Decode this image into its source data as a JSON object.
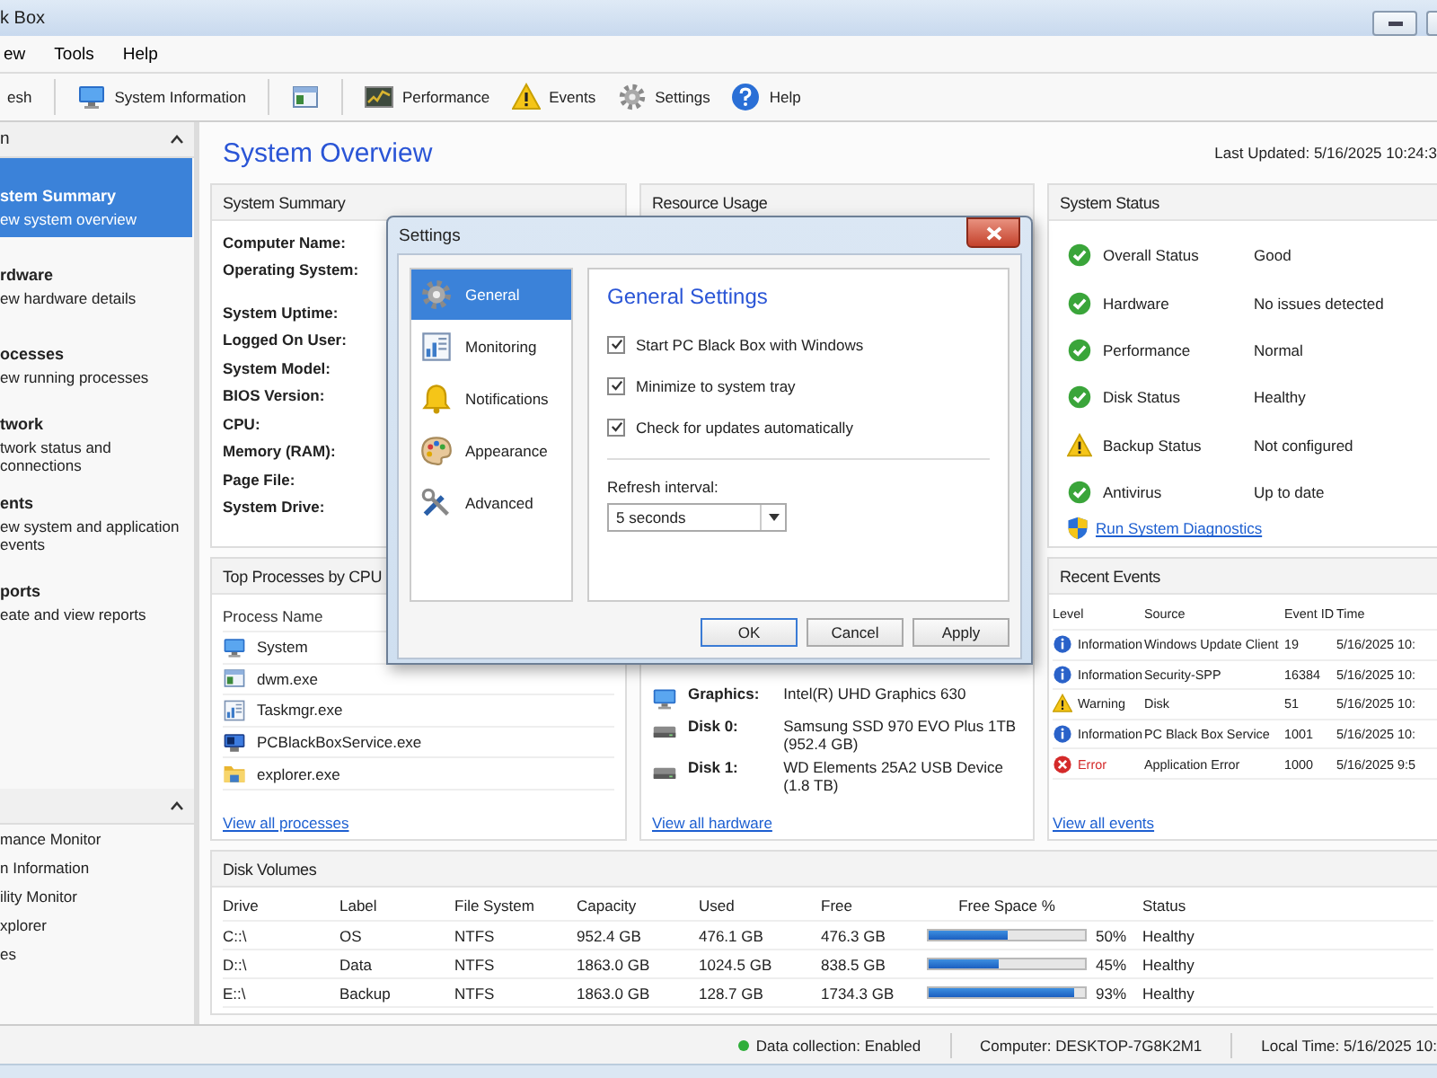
{
  "window": {
    "title": "k Box"
  },
  "menu": [
    {
      "label": "ew"
    },
    {
      "label": "Tools"
    },
    {
      "label": "Help"
    }
  ],
  "toolbar": [
    {
      "kind": "button",
      "label": "esh"
    },
    {
      "kind": "separator"
    },
    {
      "kind": "button",
      "label": "System Information"
    },
    {
      "kind": "separator"
    },
    {
      "kind": "button"
    },
    {
      "kind": "separator"
    },
    {
      "kind": "button",
      "label": "Performance"
    },
    {
      "kind": "button",
      "label": "Events"
    },
    {
      "kind": "button",
      "label": "Settings"
    },
    {
      "kind": "button",
      "label": "Help"
    }
  ],
  "sidebar": {
    "sections": [
      {
        "title": "n",
        "expanded": true,
        "items": [
          {
            "title": "stem Summary",
            "subtitle": "ew system overview",
            "selected": true
          },
          {
            "title": "rdware",
            "subtitle": "ew hardware details",
            "selected": false
          },
          {
            "title": "ocesses",
            "subtitle": "ew running processes",
            "selected": false
          },
          {
            "title": "twork",
            "subtitle": "twork status and connections",
            "selected": false
          },
          {
            "title": "ents",
            "subtitle": "ew system and application events",
            "selected": false
          },
          {
            "title": "ports",
            "subtitle": "eate and view reports",
            "selected": false
          }
        ]
      },
      {
        "expanded": true,
        "items": [
          {
            "title": "mance Monitor",
            "selected": false
          },
          {
            "title": "n Information",
            "selected": false
          },
          {
            "title": "ility Monitor",
            "selected": false
          },
          {
            "title": "xplorer",
            "selected": false
          },
          {
            "title": "es",
            "selected": false
          }
        ]
      }
    ]
  },
  "main": {
    "title": "System Overview",
    "last_updated": "Last Updated: 5/16/2025 10:24:3"
  },
  "system_summary": {
    "title": "System Summary",
    "fields": [
      "Computer Name:",
      "Operating System:",
      "System Uptime:",
      "Logged On User:",
      "System Model:",
      "BIOS Version:",
      "CPU:",
      "Memory (RAM):",
      "Page File:",
      "System Drive:"
    ]
  },
  "resource_usage": {
    "title": "Resource Usage",
    "rows": [
      {
        "kind": "graphics",
        "label": "Graphics:",
        "value": "Intel(R) UHD Graphics 630"
      },
      {
        "kind": "disk",
        "label": "Disk 0:",
        "value": "Samsung SSD 970 EVO Plus 1TB (952.4 GB)"
      },
      {
        "kind": "disk",
        "label": "Disk 1:",
        "value": "WD Elements 25A2 USB Device (1.8 TB)"
      }
    ],
    "link": "View all hardware"
  },
  "top_processes": {
    "title": "Top Processes by CPU",
    "columns": [
      "Process Name"
    ],
    "rows": [
      {
        "name": "System"
      },
      {
        "name": "dwm.exe"
      },
      {
        "name": "Taskmgr.exe"
      },
      {
        "name": "PCBlackBoxService.exe"
      },
      {
        "name": "explorer.exe"
      }
    ],
    "link": "View all processes"
  },
  "system_status": {
    "title": "System Status",
    "items": [
      {
        "kind": "ok",
        "label": "Overall Status",
        "value": "Good"
      },
      {
        "kind": "ok",
        "label": "Hardware",
        "value": "No issues detected"
      },
      {
        "kind": "ok",
        "label": "Performance",
        "value": "Normal"
      },
      {
        "kind": "ok",
        "label": "Disk Status",
        "value": "Healthy"
      },
      {
        "kind": "warning",
        "label": "Backup Status",
        "value": "Not configured"
      },
      {
        "kind": "ok",
        "label": "Antivirus",
        "value": "Up to date"
      }
    ],
    "link": "Run System Diagnostics"
  },
  "recent_events": {
    "title": "Recent Events",
    "columns": [
      "Level",
      "Source",
      "Event ID",
      "Time"
    ],
    "rows": [
      {
        "kind": "info",
        "level": "Information",
        "source": "Windows Update Client",
        "event_id": "19",
        "time": "5/16/2025 10:"
      },
      {
        "kind": "info",
        "level": "Information",
        "source": "Security-SPP",
        "event_id": "16384",
        "time": "5/16/2025 10:"
      },
      {
        "kind": "warning",
        "level": "Warning",
        "source": "Disk",
        "event_id": "51",
        "time": "5/16/2025 10:"
      },
      {
        "kind": "info",
        "level": "Information",
        "source": "PC Black Box Service",
        "event_id": "1001",
        "time": "5/16/2025 10:"
      },
      {
        "kind": "error",
        "level": "Error",
        "source": "Application Error",
        "event_id": "1000",
        "time": "5/16/2025 9:5"
      }
    ],
    "link": "View all events"
  },
  "disk_volumes": {
    "title": "Disk Volumes",
    "columns": [
      "Drive",
      "Label",
      "File System",
      "Capacity",
      "Used",
      "Free",
      "Free Space %",
      "Status"
    ],
    "rows": [
      {
        "drive": "C::\\",
        "label": "OS",
        "file_system": "NTFS",
        "capacity": "952.4 GB",
        "used": "476.1 GB",
        "free": "476.3 GB",
        "level": 0.5,
        "percent": "50%",
        "status": "Healthy"
      },
      {
        "drive": "D::\\",
        "label": "Data",
        "file_system": "NTFS",
        "capacity": "1863.0 GB",
        "used": "1024.5 GB",
        "free": "838.5 GB",
        "level": 0.45,
        "percent": "45%",
        "status": "Healthy"
      },
      {
        "drive": "E::\\",
        "label": "Backup",
        "file_system": "NTFS",
        "capacity": "1863.0 GB",
        "used": "128.7 GB",
        "free": "1734.3 GB",
        "level": 0.93,
        "percent": "93%",
        "status": "Healthy"
      }
    ]
  },
  "status_bar": {
    "data_collection": {
      "text": "Data collection: Enabled",
      "active": true
    },
    "computer": "Computer: DESKTOP-7G8K2M1",
    "local_time": "Local Time: 5/16/2025 10:"
  },
  "dialog": {
    "title": "Settings",
    "nav": [
      {
        "label": "General",
        "selected": true
      },
      {
        "label": "Monitoring",
        "selected": false
      },
      {
        "label": "Notifications",
        "selected": false
      },
      {
        "label": "Appearance",
        "selected": false
      },
      {
        "label": "Advanced",
        "selected": false
      }
    ],
    "heading": "General Settings",
    "checkboxes": [
      {
        "label": "Start PC Black Box with Windows",
        "checked": true
      },
      {
        "label": "Minimize to system tray",
        "checked": true
      },
      {
        "label": "Check for updates automatically",
        "checked": true
      }
    ],
    "refresh": {
      "label": "Refresh interval:",
      "value": "5 seconds"
    },
    "buttons": [
      {
        "label": "OK",
        "default": true
      },
      {
        "label": "Cancel",
        "default": false
      },
      {
        "label": "Apply",
        "default": false
      }
    ]
  }
}
